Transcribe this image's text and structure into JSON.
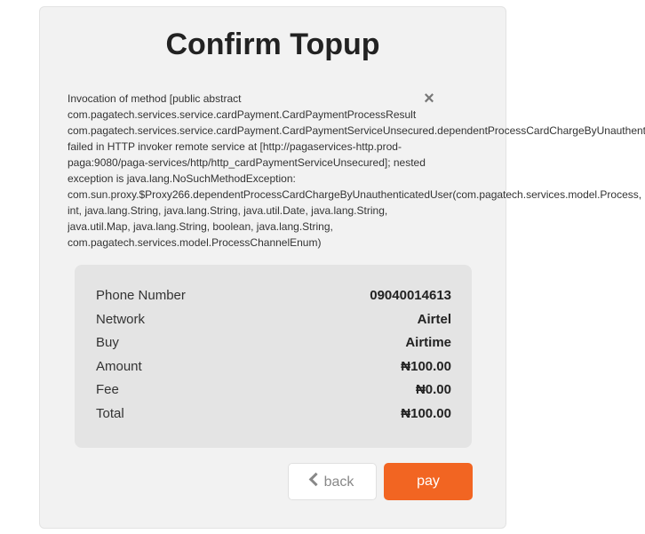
{
  "title": "Confirm Topup",
  "error": {
    "lines": [
      "Invocation of method [public abstract",
      "com.pagatech.services.service.cardPayment.CardPaymentProcessResult",
      "com.pagatech.services.service.cardPayment.CardPaymentServiceUnsecured.dependentProcessCardChargeByUnauthent",
      "failed in HTTP invoker remote service at [http://pagaservices-http.prod-",
      "paga:9080/paga-services/http/http_cardPaymentServiceUnsecured]; nested",
      "exception is java.lang.NoSuchMethodException:",
      "com.sun.proxy.$Proxy266.dependentProcessCardChargeByUnauthenticatedUser(com.pagatech.services.model.Process,",
      "int, java.lang.String, java.lang.String, java.util.Date, java.lang.String,",
      "java.util.Map, java.lang.String, boolean, java.lang.String,",
      "com.pagatech.services.model.ProcessChannelEnum)"
    ],
    "close_glyph": "×"
  },
  "summary": {
    "rows": [
      {
        "label": "Phone Number",
        "value": "09040014613"
      },
      {
        "label": "Network",
        "value": "Airtel"
      },
      {
        "label": "Buy",
        "value": "Airtime"
      },
      {
        "label": "Amount",
        "value": "₦100.00"
      },
      {
        "label": "Fee",
        "value": "₦0.00"
      },
      {
        "label": "Total",
        "value": "₦100.00"
      }
    ]
  },
  "buttons": {
    "back_label": "back",
    "pay_label": "pay"
  },
  "colors": {
    "accent": "#f26522"
  }
}
